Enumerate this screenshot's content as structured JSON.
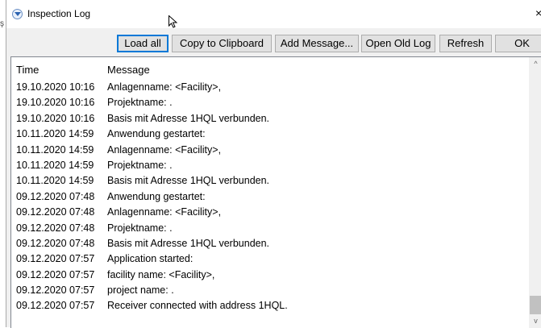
{
  "window": {
    "title": "Inspection Log"
  },
  "toolbar": {
    "load_all": "Load all",
    "copy_clipboard": "Copy to Clipboard",
    "add_message": "Add Message...",
    "open_old_log": "Open Old Log",
    "refresh": "Refresh",
    "ok": "OK"
  },
  "log": {
    "columns": {
      "time": "Time",
      "message": "Message"
    },
    "rows": [
      {
        "time": "19.10.2020 10:16",
        "message": "Anlagenname: <Facility>,"
      },
      {
        "time": "19.10.2020 10:16",
        "message": "Projektname: ."
      },
      {
        "time": "19.10.2020 10:16",
        "message": "Basis mit Adresse 1HQL verbunden."
      },
      {
        "time": "10.11.2020 14:59",
        "message": "Anwendung gestartet:"
      },
      {
        "time": "10.11.2020 14:59",
        "message": "Anlagenname: <Facility>,"
      },
      {
        "time": "10.11.2020 14:59",
        "message": "Projektname: ."
      },
      {
        "time": "10.11.2020 14:59",
        "message": "Basis mit Adresse 1HQL verbunden."
      },
      {
        "time": "09.12.2020 07:48",
        "message": "Anwendung gestartet:"
      },
      {
        "time": "09.12.2020 07:48",
        "message": "Anlagenname: <Facility>,"
      },
      {
        "time": "09.12.2020 07:48",
        "message": "Projektname: ."
      },
      {
        "time": "09.12.2020 07:48",
        "message": "Basis mit Adresse 1HQL verbunden."
      },
      {
        "time": "09.12.2020 07:57",
        "message": "Application started:"
      },
      {
        "time": "09.12.2020 07:57",
        "message": "facility name: <Facility>,"
      },
      {
        "time": "09.12.2020 07:57",
        "message": "project name: ."
      },
      {
        "time": "09.12.2020 07:57",
        "message": "Receiver connected with address 1HQL."
      }
    ]
  },
  "icons": {
    "app": "app-icon",
    "close": "close-icon",
    "cursor": "mouse-cursor-icon",
    "scroll_up": "scroll-up-arrow-icon",
    "scroll_down": "scroll-down-arrow-icon"
  },
  "colors": {
    "default_button_border": "#0078d7",
    "window_bg": "#f0f0f0"
  }
}
